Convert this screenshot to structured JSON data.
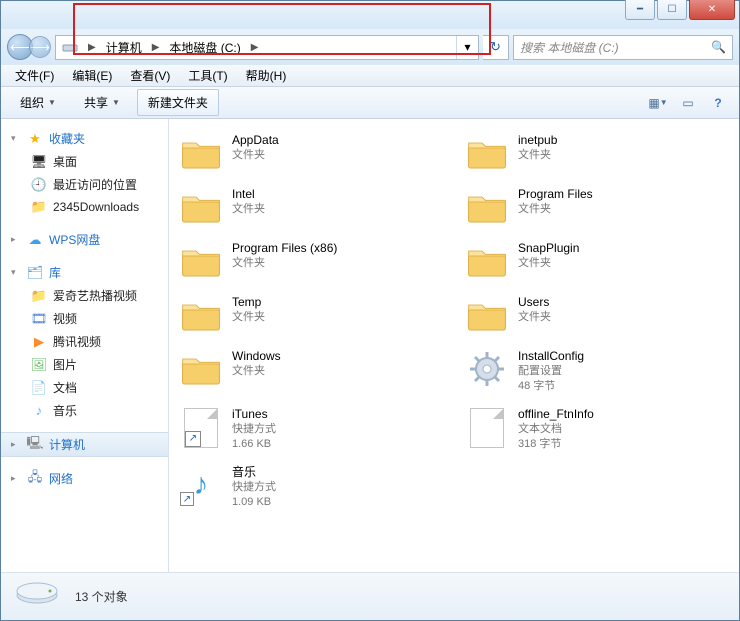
{
  "breadcrumb": {
    "root": "计算机",
    "drive": "本地磁盘 (C:)"
  },
  "search": {
    "placeholder": "搜索 本地磁盘 (C:)"
  },
  "menu": {
    "file": "文件(F)",
    "edit": "编辑(E)",
    "view": "查看(V)",
    "tools": "工具(T)",
    "help": "帮助(H)"
  },
  "toolbar": {
    "organize": "组织",
    "share": "共享",
    "newfolder": "新建文件夹"
  },
  "sidebar": {
    "favorites": {
      "label": "收藏夹",
      "items": [
        {
          "label": "桌面"
        },
        {
          "label": "最近访问的位置"
        },
        {
          "label": "2345Downloads"
        }
      ]
    },
    "wps": {
      "label": "WPS网盘"
    },
    "library": {
      "label": "库",
      "items": [
        {
          "label": "爱奇艺热播视频"
        },
        {
          "label": "视频"
        },
        {
          "label": "腾讯视频"
        },
        {
          "label": "图片"
        },
        {
          "label": "文档"
        },
        {
          "label": "音乐"
        }
      ]
    },
    "computer": {
      "label": "计算机"
    },
    "network": {
      "label": "网络"
    }
  },
  "items": [
    {
      "name": "AppData",
      "type": "文件夹",
      "kind": "folder"
    },
    {
      "name": "inetpub",
      "type": "文件夹",
      "kind": "folder"
    },
    {
      "name": "Intel",
      "type": "文件夹",
      "kind": "folder"
    },
    {
      "name": "Program Files",
      "type": "文件夹",
      "kind": "folder"
    },
    {
      "name": "Program Files (x86)",
      "type": "文件夹",
      "kind": "folder"
    },
    {
      "name": "SnapPlugin",
      "type": "文件夹",
      "kind": "folder"
    },
    {
      "name": "Temp",
      "type": "文件夹",
      "kind": "folder"
    },
    {
      "name": "Users",
      "type": "文件夹",
      "kind": "folder"
    },
    {
      "name": "Windows",
      "type": "文件夹",
      "kind": "folder"
    },
    {
      "name": "InstallConfig",
      "type": "配置设置",
      "size": "48 字节",
      "kind": "gear"
    },
    {
      "name": "iTunes",
      "type": "快捷方式",
      "size": "1.66 KB",
      "kind": "shortcut"
    },
    {
      "name": "offline_FtnInfo",
      "type": "文本文档",
      "size": "318 字节",
      "kind": "file"
    },
    {
      "name": "音乐",
      "type": "快捷方式",
      "size": "1.09 KB",
      "kind": "music-shortcut"
    }
  ],
  "status": {
    "count": "13 个对象"
  }
}
